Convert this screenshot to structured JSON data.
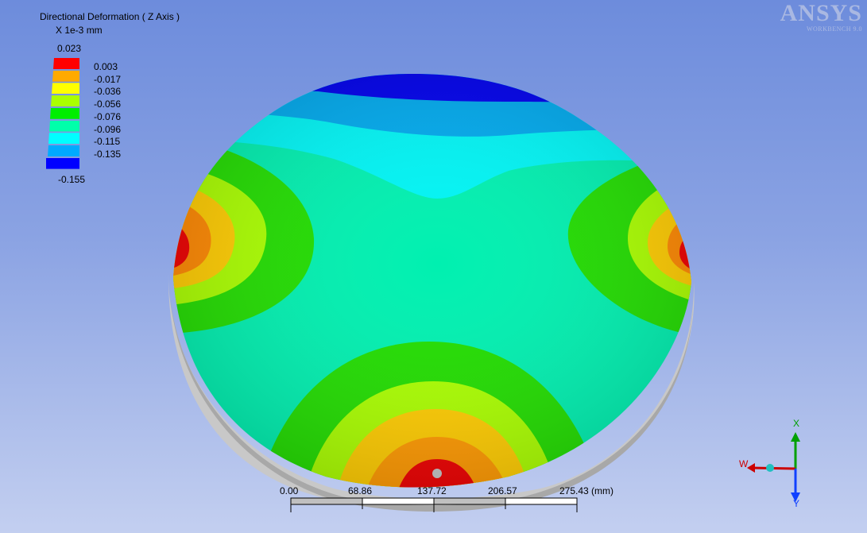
{
  "legend": {
    "title": "Directional Deformation ( Z Axis )",
    "units": "X 1e-3 mm",
    "max": "0.023",
    "min": "-0.155",
    "levels": [
      {
        "label": "0.003",
        "color": "#ff0000"
      },
      {
        "label": "-0.017",
        "color": "#ffaa00"
      },
      {
        "label": "-0.036",
        "color": "#ffff00"
      },
      {
        "label": "-0.056",
        "color": "#aaff00"
      },
      {
        "label": "-0.076",
        "color": "#00ee00"
      },
      {
        "label": "-0.096",
        "color": "#00ffaa"
      },
      {
        "label": "-0.115",
        "color": "#00ffff"
      },
      {
        "label": "-0.135",
        "color": "#00aaff"
      },
      {
        "label": "",
        "color": "#0000ff"
      }
    ]
  },
  "logo": {
    "name": "ANSYS",
    "subtitle": "WORKBENCH 9.0"
  },
  "scale_bar": {
    "ticks": [
      "0.00",
      "68.86",
      "137.72",
      "206.57",
      "275.43 (mm)"
    ]
  },
  "triad": {
    "x_label": "X",
    "w_label": "W",
    "y_label": "Y"
  },
  "colors": {
    "red": "#ff0000",
    "orange": "#ff9900",
    "yellow": "#ffff00",
    "lime": "#aaff00",
    "green": "#22dd00",
    "aqua": "#00ffaa",
    "cyan": "#00ffee",
    "sky": "#0099ee",
    "blue": "#0000ee"
  }
}
